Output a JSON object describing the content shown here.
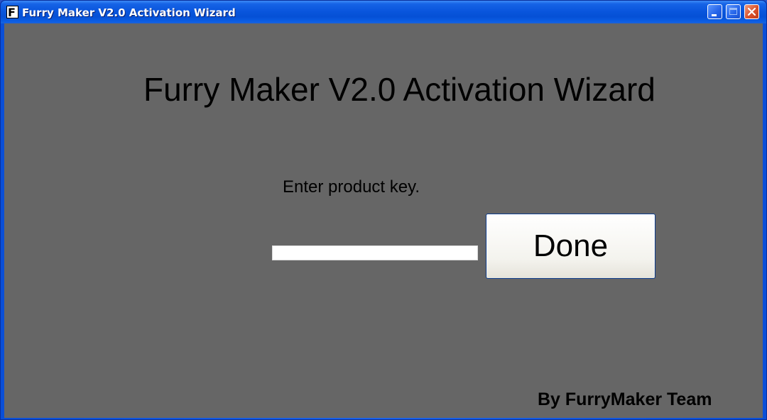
{
  "window": {
    "title": "Furry Maker V2.0 Activation Wizard",
    "icon_letter": "F",
    "icon": "app-f-icon",
    "controls": {
      "minimize": "minimize-icon",
      "maximize": "maximize-icon",
      "close": "close-icon"
    }
  },
  "main": {
    "heading": "Furry Maker V2.0 Activation Wizard",
    "prompt": "Enter product key.",
    "product_key": {
      "value": "",
      "placeholder": ""
    },
    "done_label": "Done",
    "credit": "By FurryMaker Team"
  },
  "colors": {
    "client_background": "#666666",
    "titlebar_blue": "#0a56dd",
    "close_red": "#d9512c"
  }
}
